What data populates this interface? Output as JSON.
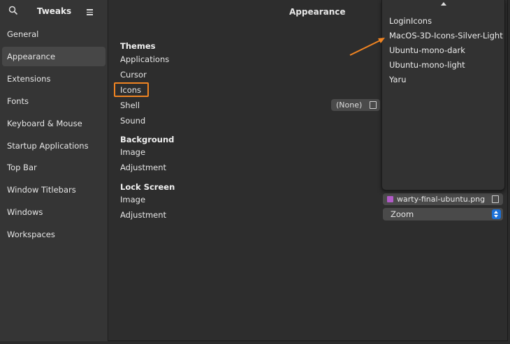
{
  "sidebar": {
    "title": "Tweaks",
    "items": [
      {
        "label": "General",
        "active": false
      },
      {
        "label": "Appearance",
        "active": true
      },
      {
        "label": "Extensions",
        "active": false
      },
      {
        "label": "Fonts",
        "active": false
      },
      {
        "label": "Keyboard & Mouse",
        "active": false
      },
      {
        "label": "Startup Applications",
        "active": false
      },
      {
        "label": "Top Bar",
        "active": false
      },
      {
        "label": "Window Titlebars",
        "active": false
      },
      {
        "label": "Windows",
        "active": false
      },
      {
        "label": "Workspaces",
        "active": false
      }
    ]
  },
  "main": {
    "title": "Appearance",
    "themes": {
      "heading": "Themes",
      "applications": "Applications",
      "cursor": "Cursor",
      "icons": "Icons",
      "shell": "Shell",
      "shell_value": "(None)",
      "sound": "Sound"
    },
    "background": {
      "heading": "Background",
      "image": "Image",
      "adjustment": "Adjustment"
    },
    "lock_screen": {
      "heading": "Lock Screen",
      "image": "Image",
      "image_value": "warty-final-ubuntu.png",
      "adjustment": "Adjustment",
      "adjustment_value": "Zoom"
    }
  },
  "icon_popover": {
    "options": [
      "LoginIcons",
      "MacOS-3D-Icons-Silver-Light",
      "Ubuntu-mono-dark",
      "Ubuntu-mono-light",
      "Yaru"
    ]
  },
  "colors": {
    "highlight": "#f08422",
    "accent": "#1c71d8"
  }
}
